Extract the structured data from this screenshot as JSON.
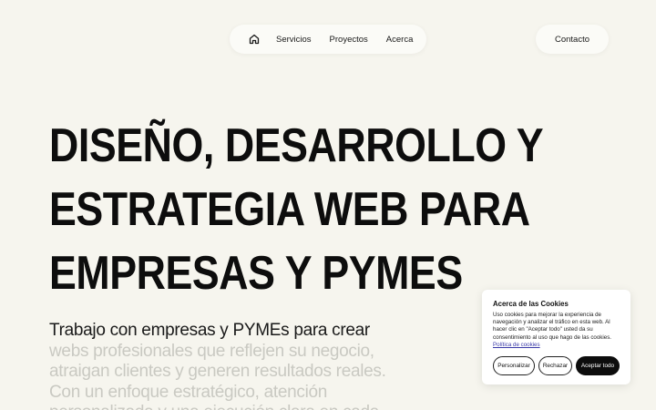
{
  "nav": {
    "home_icon": "home-icon",
    "links": [
      "Servicios",
      "Proyectos",
      "Acerca"
    ],
    "contact": "Contacto"
  },
  "hero": {
    "title_lines": [
      "DISEÑO, DESARROLLO Y",
      "ESTRATEGIA WEB PARA",
      "EMPRESAS Y PYMES"
    ],
    "subtitle_dark": "Trabajo con empresas y PYMEs para crear",
    "subtitle_faded": "webs profesionales que reflejen su negocio, atraigan clientes y generen resultados reales. Con un enfoque estratégico, atención personalizada y una ejecución clara en cada"
  },
  "cookies": {
    "title": "Acerca de las Cookies",
    "text": "Uso cookies para mejorar la experiencia de navegación y analizar el tráfico en esta web. Al hacer clic en \"Aceptar todo\" usted da su consentimiento al uso que hago de las cookies.",
    "policy_link": "Política de cookies",
    "btn_personalize": "Personalizar",
    "btn_reject": "Rechazar",
    "btn_accept": "Aceptar todo"
  },
  "colors": {
    "background": "#f6f5ee",
    "text": "#0d0d0d",
    "faded_text": "#c9c9c2",
    "accept_button": "#0d0d0d"
  }
}
